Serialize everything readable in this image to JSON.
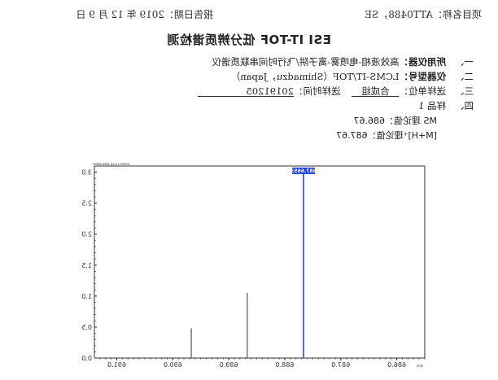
{
  "header": {
    "project": "项目名称：ATT0488，SE",
    "report_date": "报告日期：2019 年 12 月 9 日"
  },
  "title": "ESI IT-TOF 低分辨质谱检测",
  "rows": [
    {
      "num": "一、",
      "label": "所用仪器：",
      "value": "高效液相-电喷雾-离子阱/飞行时间串联质谱仪"
    },
    {
      "num": "二、",
      "label": "仪器型号：",
      "value": "LCMS-IT/TOF（Shimadzu，Japan）"
    },
    {
      "num": "三、",
      "label": "送样单位：",
      "unit": "合成组",
      "time_label": "送样时间：",
      "time": "20191205"
    },
    {
      "num": "四、",
      "label": "样品 1"
    }
  ],
  "calc": {
    "ms": "MS 理论值：686.67",
    "mh": "[M+H]⁺理论值：687.67"
  },
  "chart_data": {
    "type": "bar",
    "title": "",
    "xlabel": "m/z",
    "ylabel": "Inten.(x10,000,000)",
    "xlim": [
      685.5,
      691.4
    ],
    "ylim": [
      0,
      3.1
    ],
    "x_ticks": [
      686.0,
      687.0,
      688.0,
      689.0,
      690.0,
      691.0
    ],
    "x_tick_labels": [
      "686.0",
      "687.0",
      "688.0",
      "689.0",
      "690.0",
      "691.0"
    ],
    "y_ticks": [
      0.0,
      0.5,
      1.0,
      1.5,
      2.0,
      2.5,
      3.0
    ],
    "y_tick_labels": [
      "0.0",
      "0.5",
      "1.0",
      "1.5",
      "2.0",
      "2.5",
      "3.0"
    ],
    "peaks": [
      {
        "mz": 687.6653,
        "intensity": 2.97,
        "label": "687.6653",
        "highlight": true
      },
      {
        "mz": 688.67,
        "intensity": 1.05
      },
      {
        "mz": 689.67,
        "intensity": 0.48
      }
    ]
  }
}
